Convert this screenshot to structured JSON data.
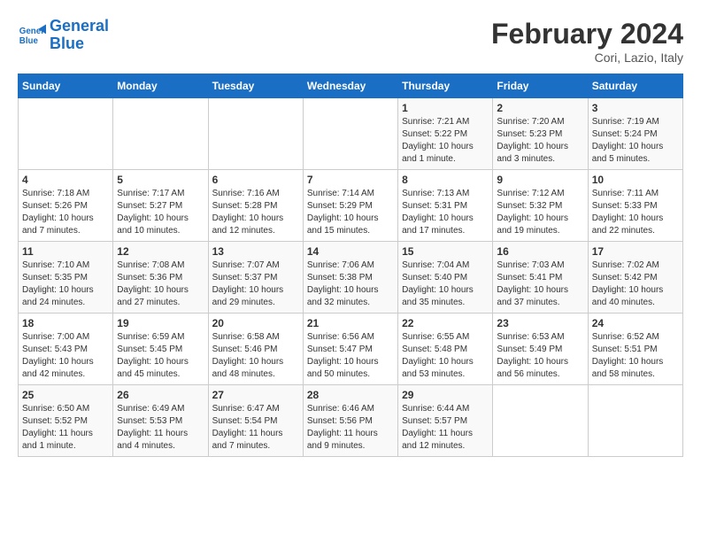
{
  "header": {
    "logo_line1": "General",
    "logo_line2": "Blue",
    "month_title": "February 2024",
    "location": "Cori, Lazio, Italy"
  },
  "days_of_week": [
    "Sunday",
    "Monday",
    "Tuesday",
    "Wednesday",
    "Thursday",
    "Friday",
    "Saturday"
  ],
  "weeks": [
    [
      {
        "day": "",
        "info": ""
      },
      {
        "day": "",
        "info": ""
      },
      {
        "day": "",
        "info": ""
      },
      {
        "day": "",
        "info": ""
      },
      {
        "day": "1",
        "info": "Sunrise: 7:21 AM\nSunset: 5:22 PM\nDaylight: 10 hours and 1 minute."
      },
      {
        "day": "2",
        "info": "Sunrise: 7:20 AM\nSunset: 5:23 PM\nDaylight: 10 hours and 3 minutes."
      },
      {
        "day": "3",
        "info": "Sunrise: 7:19 AM\nSunset: 5:24 PM\nDaylight: 10 hours and 5 minutes."
      }
    ],
    [
      {
        "day": "4",
        "info": "Sunrise: 7:18 AM\nSunset: 5:26 PM\nDaylight: 10 hours and 7 minutes."
      },
      {
        "day": "5",
        "info": "Sunrise: 7:17 AM\nSunset: 5:27 PM\nDaylight: 10 hours and 10 minutes."
      },
      {
        "day": "6",
        "info": "Sunrise: 7:16 AM\nSunset: 5:28 PM\nDaylight: 10 hours and 12 minutes."
      },
      {
        "day": "7",
        "info": "Sunrise: 7:14 AM\nSunset: 5:29 PM\nDaylight: 10 hours and 15 minutes."
      },
      {
        "day": "8",
        "info": "Sunrise: 7:13 AM\nSunset: 5:31 PM\nDaylight: 10 hours and 17 minutes."
      },
      {
        "day": "9",
        "info": "Sunrise: 7:12 AM\nSunset: 5:32 PM\nDaylight: 10 hours and 19 minutes."
      },
      {
        "day": "10",
        "info": "Sunrise: 7:11 AM\nSunset: 5:33 PM\nDaylight: 10 hours and 22 minutes."
      }
    ],
    [
      {
        "day": "11",
        "info": "Sunrise: 7:10 AM\nSunset: 5:35 PM\nDaylight: 10 hours and 24 minutes."
      },
      {
        "day": "12",
        "info": "Sunrise: 7:08 AM\nSunset: 5:36 PM\nDaylight: 10 hours and 27 minutes."
      },
      {
        "day": "13",
        "info": "Sunrise: 7:07 AM\nSunset: 5:37 PM\nDaylight: 10 hours and 29 minutes."
      },
      {
        "day": "14",
        "info": "Sunrise: 7:06 AM\nSunset: 5:38 PM\nDaylight: 10 hours and 32 minutes."
      },
      {
        "day": "15",
        "info": "Sunrise: 7:04 AM\nSunset: 5:40 PM\nDaylight: 10 hours and 35 minutes."
      },
      {
        "day": "16",
        "info": "Sunrise: 7:03 AM\nSunset: 5:41 PM\nDaylight: 10 hours and 37 minutes."
      },
      {
        "day": "17",
        "info": "Sunrise: 7:02 AM\nSunset: 5:42 PM\nDaylight: 10 hours and 40 minutes."
      }
    ],
    [
      {
        "day": "18",
        "info": "Sunrise: 7:00 AM\nSunset: 5:43 PM\nDaylight: 10 hours and 42 minutes."
      },
      {
        "day": "19",
        "info": "Sunrise: 6:59 AM\nSunset: 5:45 PM\nDaylight: 10 hours and 45 minutes."
      },
      {
        "day": "20",
        "info": "Sunrise: 6:58 AM\nSunset: 5:46 PM\nDaylight: 10 hours and 48 minutes."
      },
      {
        "day": "21",
        "info": "Sunrise: 6:56 AM\nSunset: 5:47 PM\nDaylight: 10 hours and 50 minutes."
      },
      {
        "day": "22",
        "info": "Sunrise: 6:55 AM\nSunset: 5:48 PM\nDaylight: 10 hours and 53 minutes."
      },
      {
        "day": "23",
        "info": "Sunrise: 6:53 AM\nSunset: 5:49 PM\nDaylight: 10 hours and 56 minutes."
      },
      {
        "day": "24",
        "info": "Sunrise: 6:52 AM\nSunset: 5:51 PM\nDaylight: 10 hours and 58 minutes."
      }
    ],
    [
      {
        "day": "25",
        "info": "Sunrise: 6:50 AM\nSunset: 5:52 PM\nDaylight: 11 hours and 1 minute."
      },
      {
        "day": "26",
        "info": "Sunrise: 6:49 AM\nSunset: 5:53 PM\nDaylight: 11 hours and 4 minutes."
      },
      {
        "day": "27",
        "info": "Sunrise: 6:47 AM\nSunset: 5:54 PM\nDaylight: 11 hours and 7 minutes."
      },
      {
        "day": "28",
        "info": "Sunrise: 6:46 AM\nSunset: 5:56 PM\nDaylight: 11 hours and 9 minutes."
      },
      {
        "day": "29",
        "info": "Sunrise: 6:44 AM\nSunset: 5:57 PM\nDaylight: 11 hours and 12 minutes."
      },
      {
        "day": "",
        "info": ""
      },
      {
        "day": "",
        "info": ""
      }
    ]
  ]
}
